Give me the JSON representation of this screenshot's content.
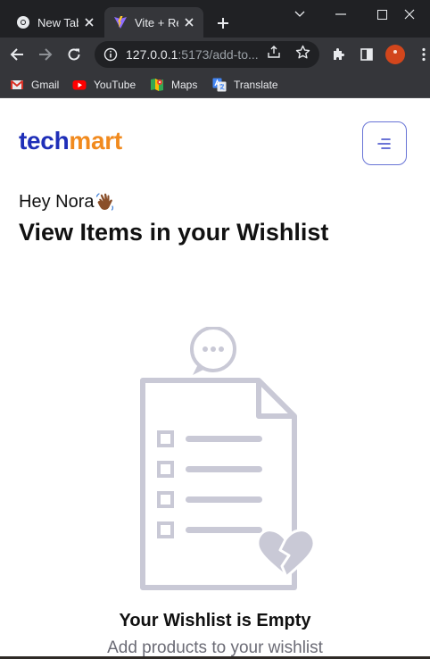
{
  "browser": {
    "tabs": [
      {
        "title": "New Tab"
      },
      {
        "title": "Vite + React",
        "active": true
      }
    ],
    "address": {
      "host": "127.0.0.1",
      "rest": ":5173/add-to..."
    },
    "bookmarks": [
      {
        "label": "Gmail",
        "icon": "gmail-icon"
      },
      {
        "label": "YouTube",
        "icon": "youtube-icon"
      },
      {
        "label": "Maps",
        "icon": "maps-icon"
      },
      {
        "label": "Translate",
        "icon": "translate-icon"
      }
    ],
    "colors": {
      "tabbar": "#202124",
      "toolbar": "#35363a",
      "omnibox": "#202124"
    }
  },
  "site": {
    "logo": {
      "part1": "tech",
      "part2": "mart"
    },
    "greeting": "Hey Nora",
    "heading": "View Items in your Wishlist",
    "empty_title": "Your Wishlist is Empty",
    "empty_subtitle": "Add products to your wishlist",
    "colors": {
      "brand_blue": "#1f2fb8",
      "brand_orange": "#f18a1e",
      "illustration_gray": "#c9c9d6"
    }
  }
}
